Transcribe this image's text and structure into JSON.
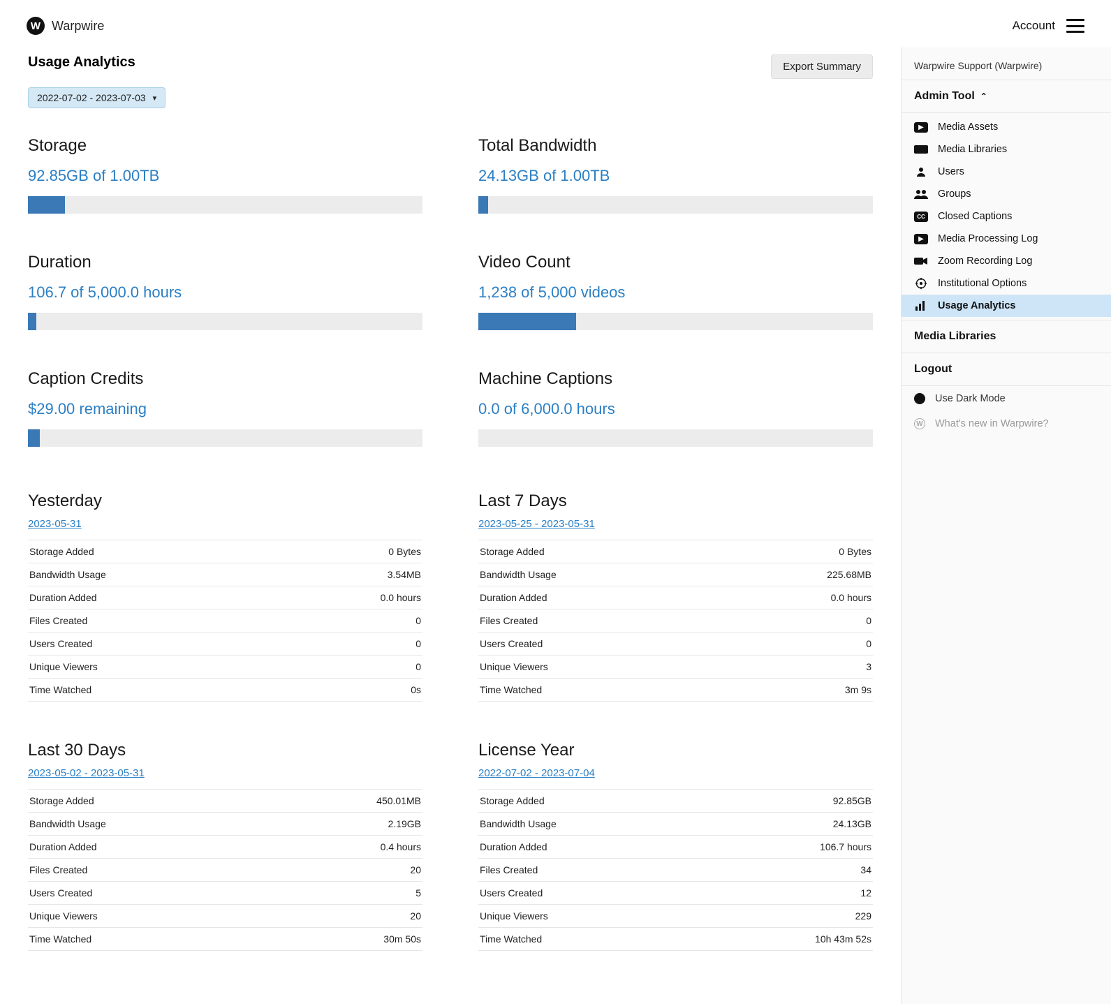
{
  "brand": {
    "name": "Warpwire",
    "glyph": "W"
  },
  "topnav": {
    "account": "Account"
  },
  "page": {
    "title": "Usage Analytics",
    "export_label": "Export Summary",
    "date_range": "2022-07-02 - 2023-07-03"
  },
  "metrics": {
    "storage": {
      "title": "Storage",
      "value": "92.85GB of 1.00TB",
      "pct": 9.3
    },
    "bandwidth": {
      "title": "Total Bandwidth",
      "value": "24.13GB of 1.00TB",
      "pct": 2.4
    },
    "duration": {
      "title": "Duration",
      "value": "106.7 of 5,000.0 hours",
      "pct": 2.1
    },
    "video_count": {
      "title": "Video Count",
      "value": "1,238 of 5,000 videos",
      "pct": 24.8
    },
    "caption_credits": {
      "title": "Caption Credits",
      "value": "$29.00 remaining",
      "pct": 3.0
    },
    "machine_captions": {
      "title": "Machine Captions",
      "value": "0.0 of 6,000.0 hours",
      "pct": 0
    }
  },
  "stat_keys": [
    "storage_added",
    "bandwidth_usage",
    "duration_added",
    "files_created",
    "users_created",
    "unique_viewers",
    "time_watched"
  ],
  "stat_labels": {
    "storage_added": "Storage Added",
    "bandwidth_usage": "Bandwidth Usage",
    "duration_added": "Duration Added",
    "files_created": "Files Created",
    "users_created": "Users Created",
    "unique_viewers": "Unique Viewers",
    "time_watched": "Time Watched"
  },
  "periods": {
    "yesterday": {
      "title": "Yesterday",
      "range": "2023-05-31",
      "stats": {
        "storage_added": "0 Bytes",
        "bandwidth_usage": "3.54MB",
        "duration_added": "0.0 hours",
        "files_created": "0",
        "users_created": "0",
        "unique_viewers": "0",
        "time_watched": "0s"
      }
    },
    "last7": {
      "title": "Last 7 Days",
      "range": "2023-05-25 - 2023-05-31",
      "stats": {
        "storage_added": "0 Bytes",
        "bandwidth_usage": "225.68MB",
        "duration_added": "0.0 hours",
        "files_created": "0",
        "users_created": "0",
        "unique_viewers": "3",
        "time_watched": "3m 9s"
      }
    },
    "last30": {
      "title": "Last 30 Days",
      "range": "2023-05-02 - 2023-05-31",
      "stats": {
        "storage_added": "450.01MB",
        "bandwidth_usage": "2.19GB",
        "duration_added": "0.4 hours",
        "files_created": "20",
        "users_created": "5",
        "unique_viewers": "20",
        "time_watched": "30m 50s"
      }
    },
    "license": {
      "title": "License Year",
      "range": "2022-07-02 - 2023-07-04",
      "stats": {
        "storage_added": "92.85GB",
        "bandwidth_usage": "24.13GB",
        "duration_added": "106.7 hours",
        "files_created": "34",
        "users_created": "12",
        "unique_viewers": "229",
        "time_watched": "10h 43m 52s"
      }
    }
  },
  "sidebar": {
    "support": "Warpwire Support (Warpwire)",
    "admin_header": "Admin Tool",
    "items": [
      {
        "label": "Media Assets",
        "icon": "play"
      },
      {
        "label": "Media Libraries",
        "icon": "library"
      },
      {
        "label": "Users",
        "icon": "user"
      },
      {
        "label": "Groups",
        "icon": "group"
      },
      {
        "label": "Closed Captions",
        "icon": "cc"
      },
      {
        "label": "Media Processing Log",
        "icon": "play"
      },
      {
        "label": "Zoom Recording Log",
        "icon": "camera"
      },
      {
        "label": "Institutional Options",
        "icon": "gear"
      },
      {
        "label": "Usage Analytics",
        "icon": "bars",
        "active": true
      }
    ],
    "media_libraries": "Media Libraries",
    "logout": "Logout",
    "dark_mode": "Use Dark Mode",
    "whats_new": "What's new in Warpwire?"
  }
}
